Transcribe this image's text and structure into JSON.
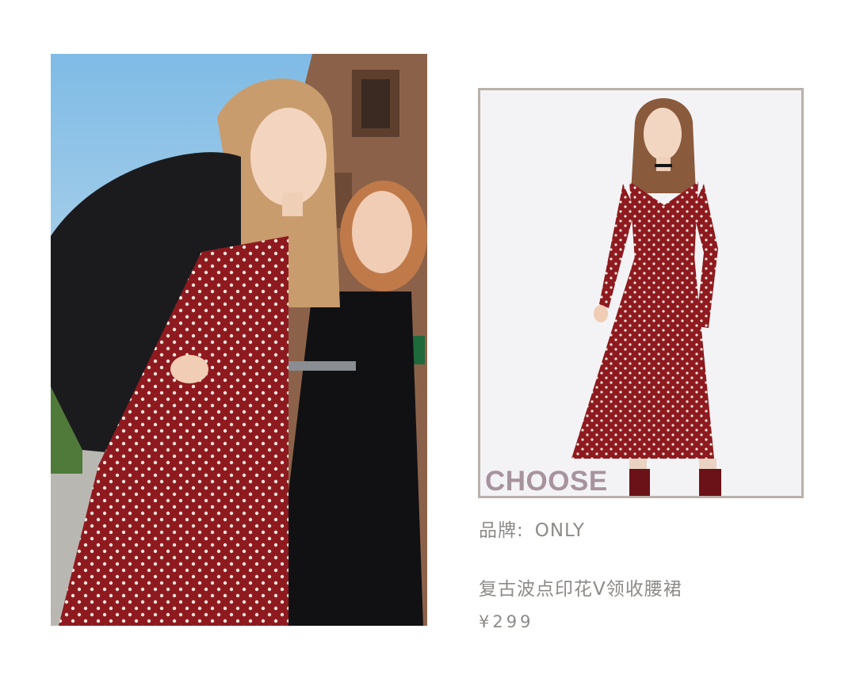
{
  "product_card": {
    "overlay_label": "CHOOSE",
    "brand_label": "品牌:",
    "brand_value": "ONLY",
    "product_name": "复古波点印花V领收腰裙",
    "price": "¥299"
  },
  "colors": {
    "dress_red": "#8e1a1f",
    "polka_dot": "#f1e6dc",
    "frame_border": "#b9b1aa",
    "overlay_text": "#a7939e",
    "info_text": "#8d8a88",
    "sky": "#8fc3e6",
    "jacket": "#1b1b1e"
  }
}
